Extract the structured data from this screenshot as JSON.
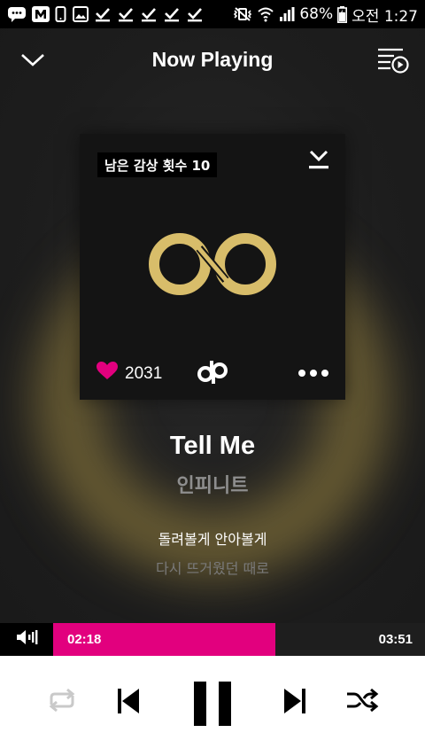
{
  "status_bar": {
    "battery": "68%",
    "time": "오전 1:27",
    "left_icons": [
      "chat-icon",
      "m-app-icon",
      "phone-icon",
      "image-icon",
      "check-icon",
      "check-icon",
      "check-icon",
      "check-icon",
      "check-icon"
    ],
    "right_icons": [
      "vibrate-mute-icon",
      "wifi-icon",
      "signal-icon",
      "battery-icon"
    ]
  },
  "header": {
    "title": "Now Playing",
    "left_icon": "chevron-down-icon",
    "right_icon": "playlist-icon"
  },
  "album": {
    "remaining_plays": "남은 감상 횟수 10",
    "like_count": "2031",
    "accent_color": "#e2007e",
    "logo_color": "#d8bd6a"
  },
  "song": {
    "title": "Tell Me",
    "artist": "인피니트",
    "lyric_current": "돌려볼게 안아볼게",
    "lyric_next": "다시 뜨거웠던 때로"
  },
  "player": {
    "current_time": "02:18",
    "total_time": "03:51",
    "progress": 0.597,
    "controls": [
      "repeat-icon",
      "previous-icon",
      "pause-icon",
      "next-icon",
      "shuffle-icon"
    ]
  }
}
